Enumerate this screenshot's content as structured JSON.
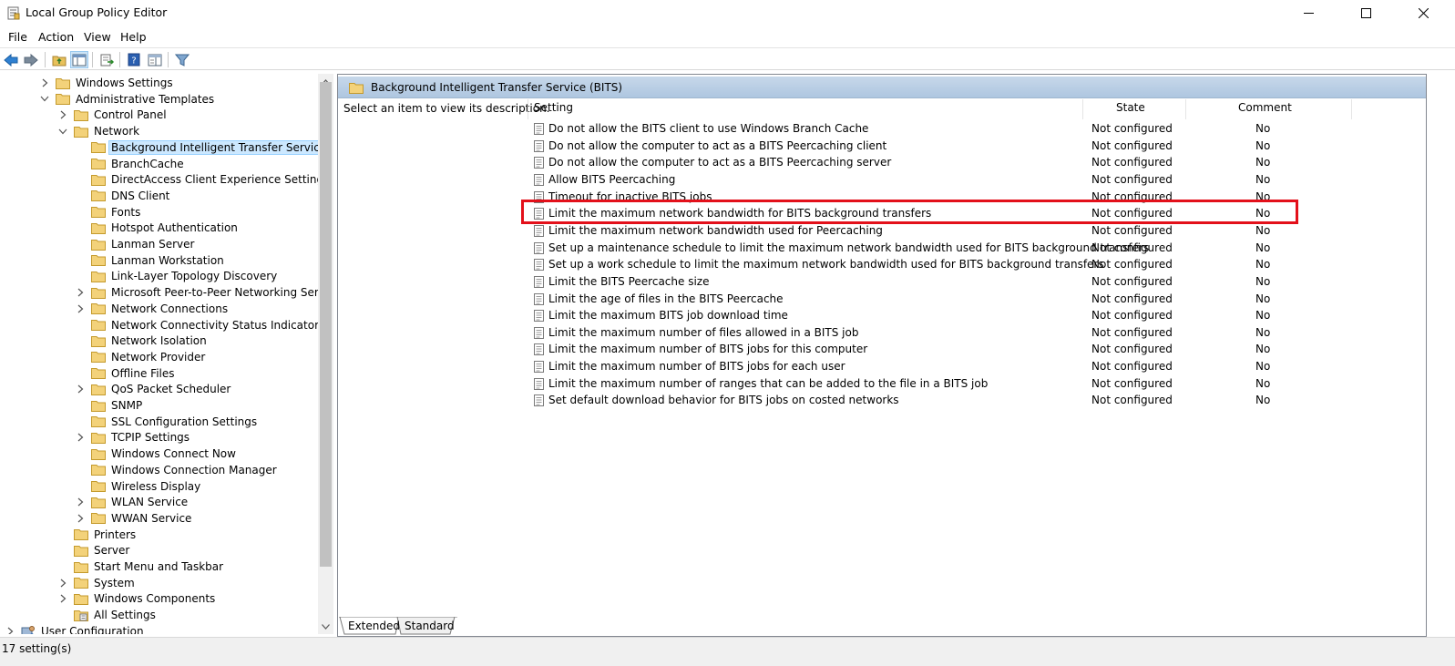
{
  "window": {
    "title": "Local Group Policy Editor"
  },
  "menu": [
    "File",
    "Action",
    "View",
    "Help"
  ],
  "toolbar": {
    "buttons": [
      "back-icon",
      "forward-icon",
      "up-folder-icon",
      "show-hide-tree-icon",
      "export-list-icon",
      "help-icon",
      "extended-view-icon",
      "filter-icon"
    ]
  },
  "tree": {
    "items": [
      {
        "label": "Windows Settings",
        "level": 1,
        "expand": "collapsed"
      },
      {
        "label": "Administrative Templates",
        "level": 1,
        "expand": "expanded"
      },
      {
        "label": "Control Panel",
        "level": 2,
        "expand": "collapsed"
      },
      {
        "label": "Network",
        "level": 2,
        "expand": "expanded"
      },
      {
        "label": "Background Intelligent Transfer Service (BITS)",
        "level": 3,
        "expand": "none",
        "selected": true
      },
      {
        "label": "BranchCache",
        "level": 3,
        "expand": "none"
      },
      {
        "label": "DirectAccess Client Experience Settings",
        "level": 3,
        "expand": "none"
      },
      {
        "label": "DNS Client",
        "level": 3,
        "expand": "none"
      },
      {
        "label": "Fonts",
        "level": 3,
        "expand": "none"
      },
      {
        "label": "Hotspot Authentication",
        "level": 3,
        "expand": "none"
      },
      {
        "label": "Lanman Server",
        "level": 3,
        "expand": "none"
      },
      {
        "label": "Lanman Workstation",
        "level": 3,
        "expand": "none"
      },
      {
        "label": "Link-Layer Topology Discovery",
        "level": 3,
        "expand": "none"
      },
      {
        "label": "Microsoft Peer-to-Peer Networking Services",
        "level": 3,
        "expand": "collapsed"
      },
      {
        "label": "Network Connections",
        "level": 3,
        "expand": "collapsed"
      },
      {
        "label": "Network Connectivity Status Indicator",
        "level": 3,
        "expand": "none"
      },
      {
        "label": "Network Isolation",
        "level": 3,
        "expand": "none"
      },
      {
        "label": "Network Provider",
        "level": 3,
        "expand": "none"
      },
      {
        "label": "Offline Files",
        "level": 3,
        "expand": "none"
      },
      {
        "label": "QoS Packet Scheduler",
        "level": 3,
        "expand": "collapsed"
      },
      {
        "label": "SNMP",
        "level": 3,
        "expand": "none"
      },
      {
        "label": "SSL Configuration Settings",
        "level": 3,
        "expand": "none"
      },
      {
        "label": "TCPIP Settings",
        "level": 3,
        "expand": "collapsed"
      },
      {
        "label": "Windows Connect Now",
        "level": 3,
        "expand": "none"
      },
      {
        "label": "Windows Connection Manager",
        "level": 3,
        "expand": "none"
      },
      {
        "label": "Wireless Display",
        "level": 3,
        "expand": "none"
      },
      {
        "label": "WLAN Service",
        "level": 3,
        "expand": "collapsed"
      },
      {
        "label": "WWAN Service",
        "level": 3,
        "expand": "collapsed"
      },
      {
        "label": "Printers",
        "level": 2,
        "expand": "none"
      },
      {
        "label": "Server",
        "level": 2,
        "expand": "none"
      },
      {
        "label": "Start Menu and Taskbar",
        "level": 2,
        "expand": "none"
      },
      {
        "label": "System",
        "level": 2,
        "expand": "collapsed"
      },
      {
        "label": "Windows Components",
        "level": 2,
        "expand": "collapsed"
      },
      {
        "label": "All Settings",
        "level": 2,
        "expand": "none",
        "icon": "all-settings-icon"
      },
      {
        "label": "User Configuration",
        "level": 0,
        "expand": "collapsed",
        "icon": "user-config-icon"
      }
    ]
  },
  "main": {
    "header": "Background Intelligent Transfer Service (BITS)",
    "description": "Select an item to view its description.",
    "columns": {
      "setting": "Setting",
      "state": "State",
      "comment": "Comment"
    },
    "rows": [
      {
        "setting": "Do not allow the BITS client to use Windows Branch Cache",
        "state": "Not configured",
        "comment": "No"
      },
      {
        "setting": "Do not allow the computer to act as a BITS Peercaching client",
        "state": "Not configured",
        "comment": "No"
      },
      {
        "setting": "Do not allow the computer to act as a BITS Peercaching server",
        "state": "Not configured",
        "comment": "No"
      },
      {
        "setting": "Allow BITS Peercaching",
        "state": "Not configured",
        "comment": "No"
      },
      {
        "setting": "Timeout for inactive BITS jobs",
        "state": "Not configured",
        "comment": "No"
      },
      {
        "setting": "Limit the maximum network bandwidth for BITS background transfers",
        "state": "Not configured",
        "comment": "No",
        "highlighted": true
      },
      {
        "setting": "Limit the maximum network bandwidth used for Peercaching",
        "state": "Not configured",
        "comment": "No"
      },
      {
        "setting": "Set up a maintenance schedule to limit the maximum network bandwidth used for BITS background transfers",
        "state": "Not configured",
        "comment": "No"
      },
      {
        "setting": "Set up a work schedule to limit the maximum network bandwidth used for BITS background transfers",
        "state": "Not configured",
        "comment": "No"
      },
      {
        "setting": "Limit the BITS Peercache size",
        "state": "Not configured",
        "comment": "No"
      },
      {
        "setting": "Limit the age of files in the BITS Peercache",
        "state": "Not configured",
        "comment": "No"
      },
      {
        "setting": "Limit the maximum BITS job download time",
        "state": "Not configured",
        "comment": "No"
      },
      {
        "setting": "Limit the maximum number of files allowed in a BITS job",
        "state": "Not configured",
        "comment": "No"
      },
      {
        "setting": "Limit the maximum number of BITS jobs for this computer",
        "state": "Not configured",
        "comment": "No"
      },
      {
        "setting": "Limit the maximum number of BITS jobs for each user",
        "state": "Not configured",
        "comment": "No"
      },
      {
        "setting": "Limit the maximum number of ranges that can be added to the file in a BITS job",
        "state": "Not configured",
        "comment": "No"
      },
      {
        "setting": "Set default download behavior for BITS jobs on costed networks",
        "state": "Not configured",
        "comment": "No"
      }
    ],
    "highlight_color": "#e3101a"
  },
  "tabs": [
    {
      "label": "Extended",
      "active": true
    },
    {
      "label": "Standard",
      "active": false
    }
  ],
  "status": "17 setting(s)"
}
